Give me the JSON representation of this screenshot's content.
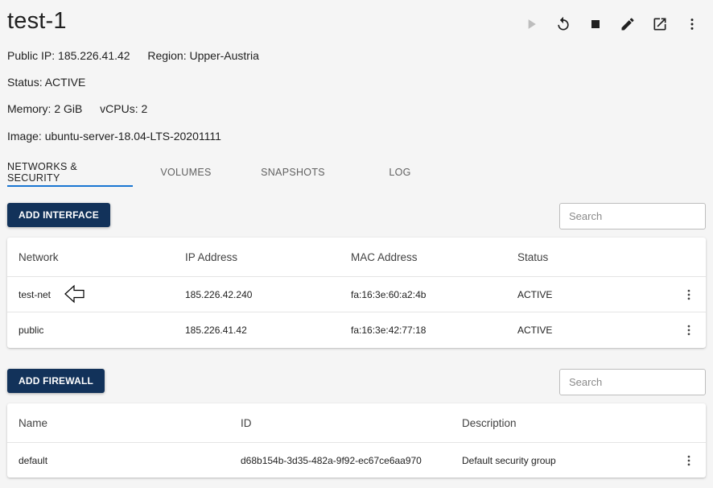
{
  "title": "test-1",
  "info": {
    "public_ip_label": "Public IP:",
    "public_ip": "185.226.41.42",
    "region_label": "Region:",
    "region": "Upper-Austria",
    "status_label": "Status:",
    "status": "ACTIVE",
    "memory_label": "Memory:",
    "memory": "2 GiB",
    "vcpus_label": "vCPUs:",
    "vcpus": "2",
    "image_label": "Image:",
    "image": "ubuntu-server-18.04-LTS-20201111"
  },
  "toolbar": {
    "icons": [
      "play-icon",
      "restart-icon",
      "stop-icon",
      "edit-icon",
      "open-external-icon",
      "more-vert-icon"
    ],
    "disabled_color": "#bdbdbd",
    "icon_color": "#212121"
  },
  "tabs": [
    {
      "label": "NETWORKS & SECURITY",
      "active": true
    },
    {
      "label": "VOLUMES",
      "active": false
    },
    {
      "label": "SNAPSHOTS",
      "active": false
    },
    {
      "label": "LOG",
      "active": false
    }
  ],
  "accent_color": "#1976d2",
  "primary_button_color": "#12325a",
  "interfaces": {
    "add_label": "ADD INTERFACE",
    "search_placeholder": "Search",
    "columns": [
      "Network",
      "IP Address",
      "MAC Address",
      "Status"
    ],
    "rows": [
      {
        "network": "test-net",
        "ip": "185.226.42.240",
        "mac": "fa:16:3e:60:a2:4b",
        "status": "ACTIVE"
      },
      {
        "network": "public",
        "ip": "185.226.41.42",
        "mac": "fa:16:3e:42:77:18",
        "status": "ACTIVE"
      }
    ]
  },
  "firewalls": {
    "add_label": "ADD FIREWALL",
    "search_placeholder": "Search",
    "columns": [
      "Name",
      "ID",
      "Description"
    ],
    "rows": [
      {
        "name": "default",
        "id": "d68b154b-3d35-482a-9f92-ec67ce6aa970",
        "description": "Default security group"
      }
    ]
  }
}
